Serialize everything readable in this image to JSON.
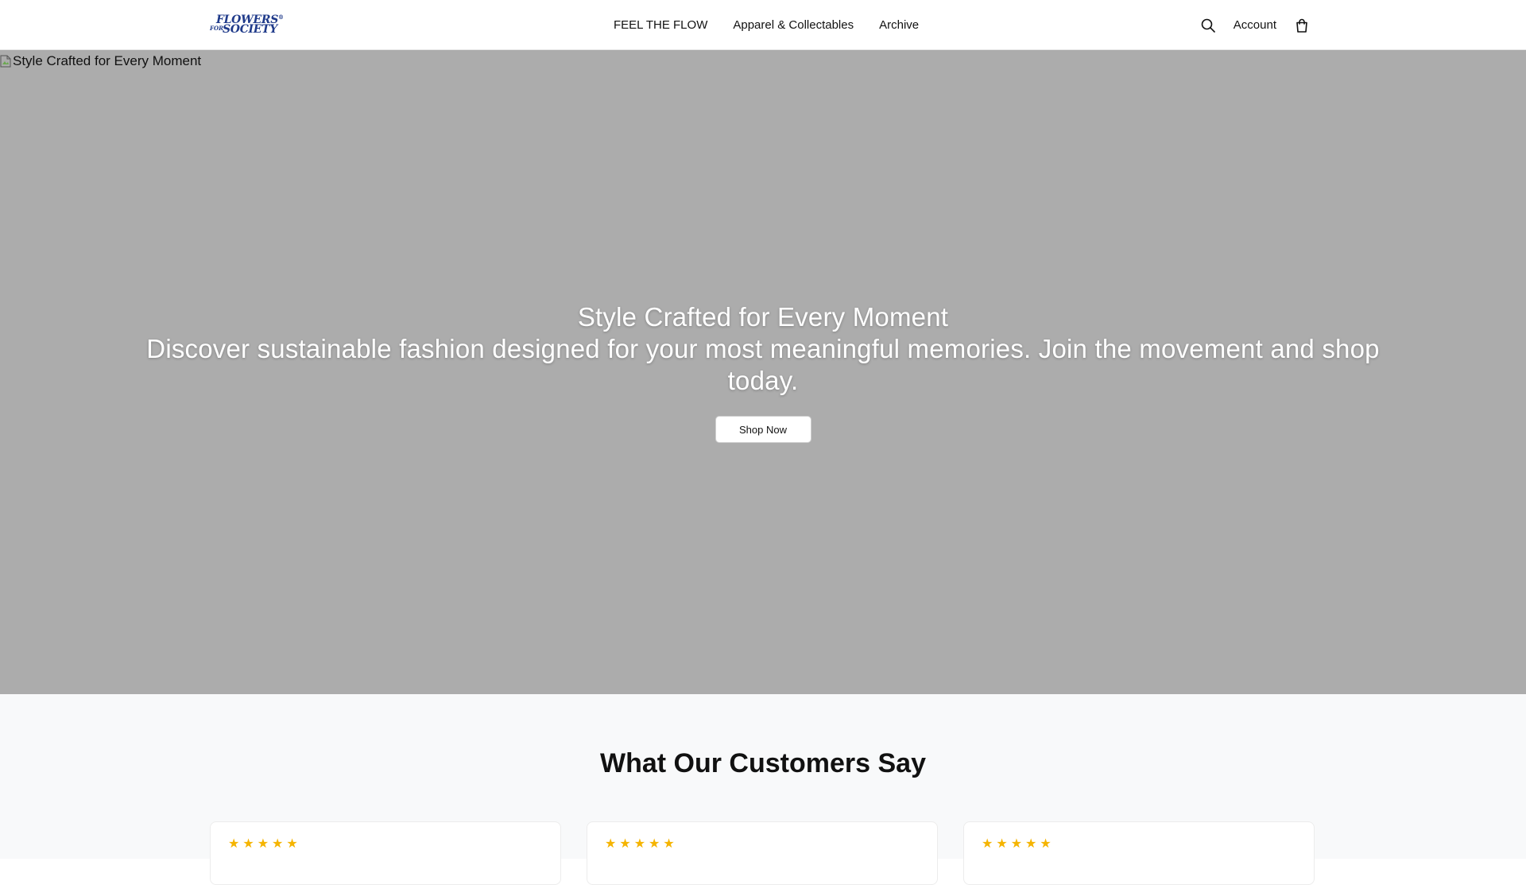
{
  "brand": {
    "logo_line1": "FLOWERS",
    "logo_mark": "®",
    "logo_for": "FOR",
    "logo_line2": "SOCIETY",
    "color": "#1f3a8a"
  },
  "nav": {
    "items": [
      {
        "label": "FEEL THE FLOW"
      },
      {
        "label": "Apparel & Collectables"
      },
      {
        "label": "Archive"
      }
    ]
  },
  "utils": {
    "search_icon": "search-icon",
    "account_label": "Account",
    "cart_icon": "shopping-bag-icon"
  },
  "hero": {
    "image_alt": "Style Crafted for Every Moment",
    "title": "Style Crafted for Every Moment",
    "subtitle": "Discover sustainable fashion designed for your most meaningful memories. Join the movement and shop today.",
    "cta_label": "Shop Now",
    "background": "#acacac"
  },
  "testimonials": {
    "title": "What Our Customers Say",
    "cards": [
      {
        "rating": 5
      },
      {
        "rating": 5
      },
      {
        "rating": 5
      }
    ],
    "star_glyph": "★",
    "star_color": "#f5b400"
  }
}
